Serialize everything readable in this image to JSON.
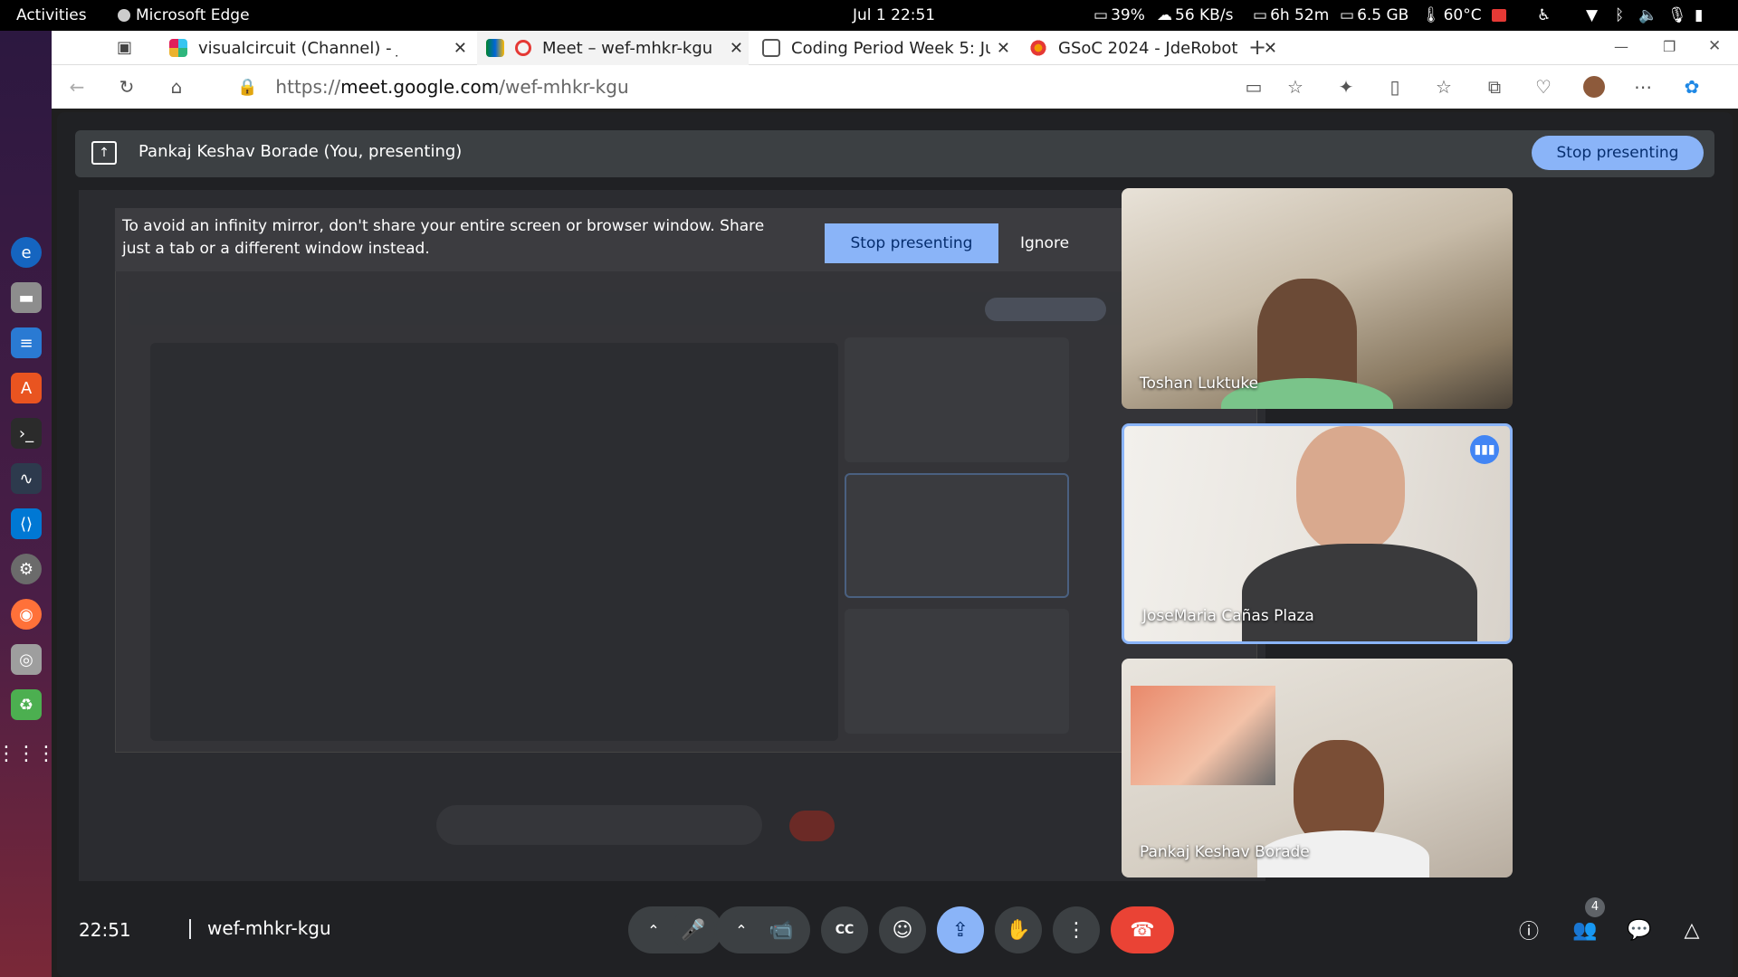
{
  "os": {
    "activities": "Activities",
    "app_name": "Microsoft Edge",
    "datetime": "Jul 1  22:51",
    "battery": "39%",
    "network": "56 KB/s",
    "screen_time": "6h 52m",
    "memory": "6.5 GB",
    "temperature": "60°C"
  },
  "browser": {
    "tabs": [
      {
        "title": "visualcircuit (Channel) - Jc",
        "color": "#e01e5a"
      },
      {
        "title": "Meet – wef-mhkr-kgu",
        "color": "#34a853"
      },
      {
        "title": "Coding Period Week 5: Ju",
        "color": "#666666"
      },
      {
        "title": "GSoC 2024 - JdeRobot",
        "color": "#f29900"
      }
    ],
    "url_prefix": "https://",
    "url_host": "meet.google.com",
    "url_path": "/wef-mhkr-kgu"
  },
  "meet": {
    "presenting_label": "Pankaj Keshav Borade (You, presenting)",
    "stop_presenting_top": "Stop presenting",
    "warning_text": "To avoid an infinity mirror, don't share your entire screen or browser window. Share just a tab or a different window instead.",
    "warning_stop": "Stop presenting",
    "warning_ignore": "Ignore",
    "participants": [
      {
        "name": "Toshan Luktuke"
      },
      {
        "name": "JoseMaria Cañas Plaza"
      },
      {
        "name": "Pankaj Keshav Borade"
      }
    ],
    "time": "22:51",
    "meeting_code": "wef-mhkr-kgu",
    "people_count": "4",
    "accent": "#8ab4f8",
    "end_call_color": "#ea4335"
  }
}
